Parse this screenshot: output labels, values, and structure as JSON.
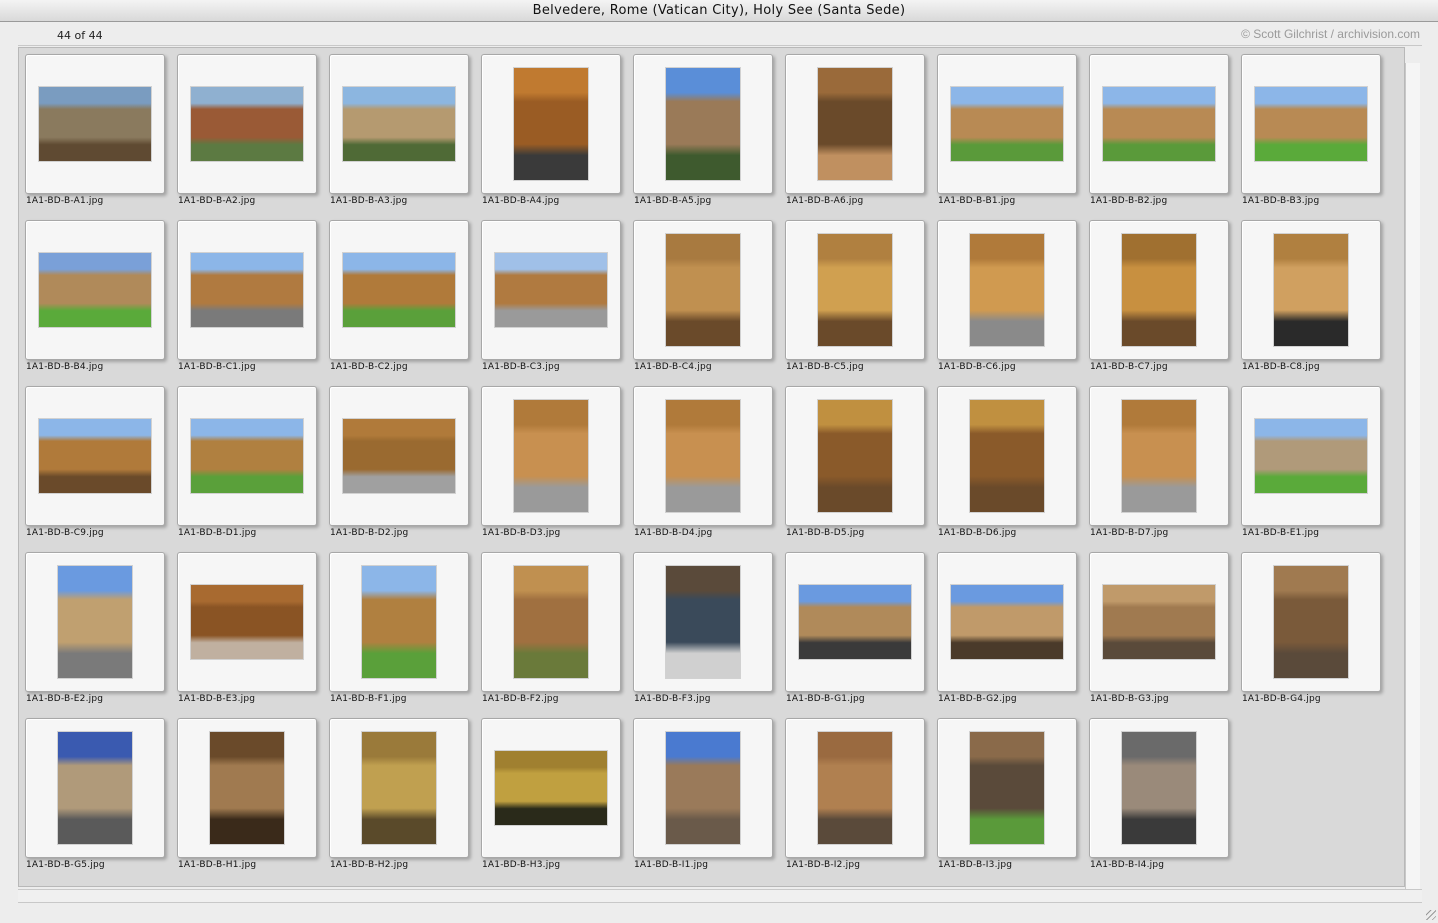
{
  "window": {
    "title": "Belvedere, Rome (Vatican City), Holy See (Santa Sede)"
  },
  "toolbar": {
    "count": "44 of 44",
    "copyright": "© Scott Gilchrist / archivision.com"
  },
  "icons": {
    "resize": "resize-grip-icon"
  },
  "items": [
    {
      "file": "1A1-BD-B-A1.jpg",
      "orient": "l",
      "palette": [
        "#7a9cc0",
        "#8a7a5e",
        "#5f4a32"
      ]
    },
    {
      "file": "1A1-BD-B-A2.jpg",
      "orient": "l",
      "palette": [
        "#8fb0d0",
        "#9a5a36",
        "#5c7a42"
      ]
    },
    {
      "file": "1A1-BD-B-A3.jpg",
      "orient": "l",
      "palette": [
        "#8cb6e0",
        "#b59a70",
        "#4f6a36"
      ]
    },
    {
      "file": "1A1-BD-B-A4.jpg",
      "orient": "p",
      "palette": [
        "#c07a30",
        "#9a5c24",
        "#3a3a3a"
      ]
    },
    {
      "file": "1A1-BD-B-A5.jpg",
      "orient": "p",
      "palette": [
        "#5a8ed8",
        "#9a7a58",
        "#3e5a2e"
      ]
    },
    {
      "file": "1A1-BD-B-A6.jpg",
      "orient": "p",
      "palette": [
        "#9a6a3a",
        "#6a4a2a",
        "#c09060"
      ]
    },
    {
      "file": "1A1-BD-B-B1.jpg",
      "orient": "l",
      "palette": [
        "#8cb6e8",
        "#b88a54",
        "#5a9a3a"
      ]
    },
    {
      "file": "1A1-BD-B-B2.jpg",
      "orient": "l",
      "palette": [
        "#8cb6e8",
        "#b88a54",
        "#5a9a3a"
      ]
    },
    {
      "file": "1A1-BD-B-B3.jpg",
      "orient": "l",
      "palette": [
        "#8cb6e8",
        "#b88a54",
        "#5aaa3a"
      ]
    },
    {
      "file": "1A1-BD-B-B4.jpg",
      "orient": "l",
      "palette": [
        "#7aa0d8",
        "#b08a5a",
        "#5aaa3a"
      ]
    },
    {
      "file": "1A1-BD-B-C1.jpg",
      "orient": "l",
      "palette": [
        "#8cb6e8",
        "#b07a40",
        "#7a7a7a"
      ]
    },
    {
      "file": "1A1-BD-B-C2.jpg",
      "orient": "l",
      "palette": [
        "#8cb6e8",
        "#b07a3a",
        "#5aa03a"
      ]
    },
    {
      "file": "1A1-BD-B-C3.jpg",
      "orient": "l",
      "palette": [
        "#a0c0e8",
        "#b07a40",
        "#9a9a9a"
      ]
    },
    {
      "file": "1A1-BD-B-C4.jpg",
      "orient": "p",
      "palette": [
        "#a87a40",
        "#c09050",
        "#6a4a2a"
      ]
    },
    {
      "file": "1A1-BD-B-C5.jpg",
      "orient": "p",
      "palette": [
        "#b08040",
        "#d0a050",
        "#6a4a2a"
      ]
    },
    {
      "file": "1A1-BD-B-C6.jpg",
      "orient": "p",
      "palette": [
        "#b07a3a",
        "#d09a50",
        "#8a8a8a"
      ]
    },
    {
      "file": "1A1-BD-B-C7.jpg",
      "orient": "p",
      "palette": [
        "#a07030",
        "#c89040",
        "#6a4a2a"
      ]
    },
    {
      "file": "1A1-BD-B-C8.jpg",
      "orient": "p",
      "palette": [
        "#b08040",
        "#d0a060",
        "#2a2a2a"
      ]
    },
    {
      "file": "1A1-BD-B-C9.jpg",
      "orient": "l",
      "palette": [
        "#8cb6e8",
        "#b07a3a",
        "#6a4a2a"
      ]
    },
    {
      "file": "1A1-BD-B-D1.jpg",
      "orient": "l",
      "palette": [
        "#8cb6e8",
        "#b08040",
        "#5aa03a"
      ]
    },
    {
      "file": "1A1-BD-B-D2.jpg",
      "orient": "l",
      "palette": [
        "#b07a3a",
        "#9a6a30",
        "#a0a0a0"
      ]
    },
    {
      "file": "1A1-BD-B-D3.jpg",
      "orient": "p",
      "palette": [
        "#b07a3a",
        "#c89050",
        "#9a9a9a"
      ]
    },
    {
      "file": "1A1-BD-B-D4.jpg",
      "orient": "p",
      "palette": [
        "#b07a3a",
        "#c89050",
        "#9a9a9a"
      ]
    },
    {
      "file": "1A1-BD-B-D5.jpg",
      "orient": "p",
      "palette": [
        "#c09040",
        "#8a5a2a",
        "#6a4a2a"
      ]
    },
    {
      "file": "1A1-BD-B-D6.jpg",
      "orient": "p",
      "palette": [
        "#c09040",
        "#8a5a2a",
        "#6a4a2a"
      ]
    },
    {
      "file": "1A1-BD-B-D7.jpg",
      "orient": "p",
      "palette": [
        "#b07a3a",
        "#c89050",
        "#9a9a9a"
      ]
    },
    {
      "file": "1A1-BD-B-E1.jpg",
      "orient": "l",
      "palette": [
        "#8cb6e8",
        "#b09a7a",
        "#5aaa3a"
      ]
    },
    {
      "file": "1A1-BD-B-E2.jpg",
      "orient": "p",
      "palette": [
        "#6a9ae0",
        "#c0a070",
        "#7a7a7a"
      ]
    },
    {
      "file": "1A1-BD-B-E3.jpg",
      "orient": "l",
      "palette": [
        "#a86a30",
        "#8a5424",
        "#c0b0a0"
      ]
    },
    {
      "file": "1A1-BD-B-F1.jpg",
      "orient": "p",
      "palette": [
        "#8cb6e8",
        "#b08040",
        "#5aa03a"
      ]
    },
    {
      "file": "1A1-BD-B-F2.jpg",
      "orient": "p",
      "palette": [
        "#c09050",
        "#a07040",
        "#6a7a3a"
      ]
    },
    {
      "file": "1A1-BD-B-F3.jpg",
      "orient": "p",
      "palette": [
        "#5a4a3a",
        "#3a4a5a",
        "#d0d0d0"
      ]
    },
    {
      "file": "1A1-BD-B-G1.jpg",
      "orient": "l",
      "palette": [
        "#6a9ae0",
        "#b08a5a",
        "#3a3a3a"
      ]
    },
    {
      "file": "1A1-BD-B-G2.jpg",
      "orient": "l",
      "palette": [
        "#6a9ae0",
        "#c09a6a",
        "#4a3a2a"
      ]
    },
    {
      "file": "1A1-BD-B-G3.jpg",
      "orient": "l",
      "palette": [
        "#c09a6a",
        "#a07a50",
        "#5a4a3a"
      ]
    },
    {
      "file": "1A1-BD-B-G4.jpg",
      "orient": "p",
      "palette": [
        "#a07a50",
        "#7a5a3a",
        "#5a4a3a"
      ]
    },
    {
      "file": "1A1-BD-B-G5.jpg",
      "orient": "p",
      "palette": [
        "#3a5ab0",
        "#b09a7a",
        "#5a5a5a"
      ]
    },
    {
      "file": "1A1-BD-B-H1.jpg",
      "orient": "p",
      "palette": [
        "#6a4a2a",
        "#a07a50",
        "#3a2a1a"
      ]
    },
    {
      "file": "1A1-BD-B-H2.jpg",
      "orient": "p",
      "palette": [
        "#9a7a3a",
        "#c0a050",
        "#5a4a2a"
      ]
    },
    {
      "file": "1A1-BD-B-H3.jpg",
      "orient": "l",
      "palette": [
        "#a08030",
        "#c0a040",
        "#2a2a1a"
      ]
    },
    {
      "file": "1A1-BD-B-I1.jpg",
      "orient": "p",
      "palette": [
        "#4a7ad0",
        "#9a7a5a",
        "#6a5a4a"
      ]
    },
    {
      "file": "1A1-BD-B-I2.jpg",
      "orient": "p",
      "palette": [
        "#9a6a40",
        "#b08050",
        "#5a4a3a"
      ]
    },
    {
      "file": "1A1-BD-B-I3.jpg",
      "orient": "p",
      "palette": [
        "#8a6a4a",
        "#5a4a3a",
        "#5a9a3a"
      ]
    },
    {
      "file": "1A1-BD-B-I4.jpg",
      "orient": "p",
      "palette": [
        "#6a6a6a",
        "#9a8a7a",
        "#3a3a3a"
      ]
    }
  ]
}
